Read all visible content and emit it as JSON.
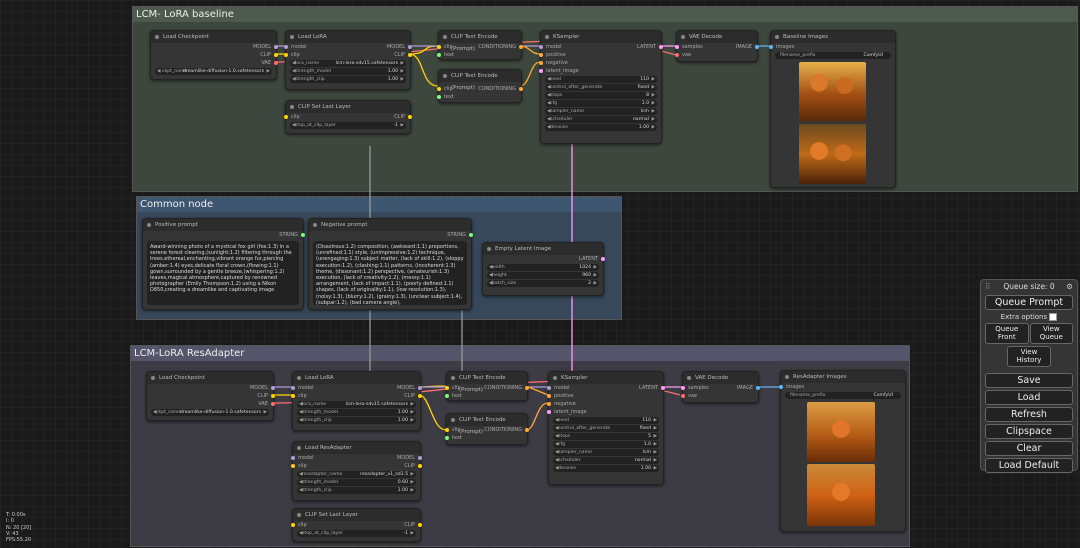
{
  "groups": {
    "baseline": "LCM- LoRA baseline",
    "common": "Common node",
    "resadapter": "LCM-LoRA ResAdapter"
  },
  "nodes": {
    "load_checkpoint": {
      "title": "Load Checkpoint",
      "out_model": "MODEL",
      "out_clip": "CLIP",
      "out_vae": "VAE",
      "ckpt_label": "ckpt_name",
      "ckpt_value": "dreamlike-diffusion-1.0.safetensors"
    },
    "load_lora": {
      "title": "Load LoRA",
      "in_model": "model",
      "in_clip": "clip",
      "out_model": "MODEL",
      "out_clip": "CLIP",
      "lora_label": "lora_name",
      "lora_value": "lcm-lora-sdv15.safetensors",
      "sm_label": "strength_model",
      "sm_value": "1.00",
      "sc_label": "strength_clip",
      "sc_value": "1.00"
    },
    "clip_set_last_layer": {
      "title": "CLIP Set Last Layer",
      "in_clip": "clip",
      "out_clip": "CLIP",
      "stop_label": "stop_at_clip_layer",
      "stop_value": "-1"
    },
    "clip_text_encode": {
      "title": "CLIP Text Encode (Prompt)",
      "in_clip": "clip",
      "in_text": "text",
      "out_cond": "CONDITIONING"
    },
    "ksampler": {
      "title": "KSampler",
      "in_model": "model",
      "in_positive": "positive",
      "in_negative": "negative",
      "in_latent": "latent_image",
      "out_latent": "LATENT",
      "widgets": [
        {
          "l": "seed",
          "v": "110"
        },
        {
          "l": "control_after_generate",
          "v": "fixed"
        },
        {
          "l": "steps",
          "v": "8"
        },
        {
          "l": "cfg",
          "v": "1.0"
        },
        {
          "l": "sampler_name",
          "v": "lcm"
        },
        {
          "l": "scheduler",
          "v": "normal"
        },
        {
          "l": "denoise",
          "v": "1.00"
        }
      ]
    },
    "ksampler2_steps": "5",
    "vae_decode": {
      "title": "VAE Decode",
      "in_samples": "samples",
      "in_vae": "vae",
      "out_image": "IMAGE"
    },
    "baseline_images": {
      "title": "Baseline Images",
      "in_images": "images",
      "prefix_label": "filename_prefix",
      "prefix_value": "ComfyUI"
    },
    "resadapter_images": {
      "title": "ResAdapter Images",
      "in_images": "images",
      "prefix_label": "filename_prefix",
      "prefix_value": "ComfyUI"
    },
    "positive_prompt": {
      "title": "Positive prompt",
      "out": "STRING",
      "text": "Award-winning photo of a mystical fox girl (fox:1.3) in a serene forest clearing,(sunlight:1.2) filtering through the trees,ethereal,enchanting,vibrant orange fur,piercing (amber:1.4) eyes,delicate floral crown,(flowing:1.1) gown,surrounded by a gentle breeze,(whispering:1.2) leaves,magical atmosphere,captured by renowned photographer (Emily Thompson:1.2) using a Nikon D850,creating a dreamlike and captivating image"
    },
    "negative_prompt": {
      "title": "Negative prompt",
      "out": "STRING",
      "text": "(Disastrous:1.2) composition, (awkward:1.1) proportions, (unrefined:1.1) style, (unimpressive:1.2) technique, (unengaging:1.3) subject matter, (lack of skill:1.2), (sloppy execution:1.2), (clashing:1.1) patterns, (incoherent:1.3) theme, (dissonant:1.2) perspective, (amateurish:1.3) execution, (lack of creativity:1.2), (messy:1.1) arrangement, (lack of impact:1.1), (poorly defined:1.1) shapes, (lack of originality:1.1), (low resolution:1.3), (noisy:1.3), (blurry:1.2), (grainy:1.3), (unclear subject:1.4), (subpar:1.2), (bad camera angle),"
    },
    "empty_latent": {
      "title": "Empty Latent Image",
      "out": "LATENT",
      "widgets": [
        {
          "l": "width",
          "v": "1024"
        },
        {
          "l": "height",
          "v": "960"
        },
        {
          "l": "batch_size",
          "v": "2"
        }
      ]
    },
    "load_resadapter": {
      "title": "Load ResAdapter",
      "in_model": "model",
      "in_clip": "clip",
      "out_model": "MODEL",
      "out_clip": "CLIP",
      "name_label": "resadapter_name",
      "name_value": "resadapter_v1_sd1.5",
      "sm_label": "strength_model",
      "sm_value": "0.60",
      "sc_label": "strength_clip",
      "sc_value": "1.00"
    }
  },
  "menu": {
    "queue_size": "Queue size: 0",
    "queue_prompt": "Queue Prompt",
    "extra_options": "Extra options",
    "queue_front": "Queue Front",
    "view_queue": "View Queue",
    "view_history": "View History",
    "save": "Save",
    "load": "Load",
    "refresh": "Refresh",
    "clipspace": "Clipspace",
    "clear": "Clear",
    "load_default": "Load Default"
  },
  "stats": [
    "T: 0.00s",
    "I: 0",
    "N: 20 [20]",
    "V: 43",
    "FPS:55.20"
  ],
  "colors": {
    "model": "#b39ddb",
    "clip": "#ffd500",
    "vae": "#ff6e6e",
    "conditioning": "#ffa931",
    "latent": "#ff9cf9",
    "image": "#64b5f6",
    "string": "#77ff77"
  }
}
